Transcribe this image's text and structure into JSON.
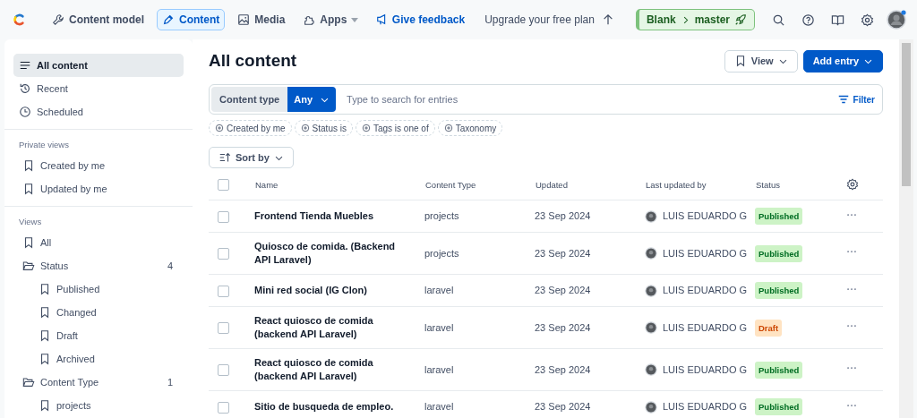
{
  "topbar": {
    "nav": [
      {
        "label": "Content model",
        "selected": false,
        "dropdown": false
      },
      {
        "label": "Content",
        "selected": true,
        "dropdown": false
      },
      {
        "label": "Media",
        "selected": false,
        "dropdown": false
      },
      {
        "label": "Apps",
        "selected": false,
        "dropdown": true
      }
    ],
    "feedback": "Give feedback",
    "upgrade": "Upgrade your free plan",
    "env_space": "Blank",
    "env_name": "master",
    "env_master": true
  },
  "sidebar": {
    "top": [
      {
        "label": "All content",
        "selected": true
      },
      {
        "label": "Recent",
        "selected": false
      },
      {
        "label": "Scheduled",
        "selected": false
      }
    ],
    "sections": [
      {
        "title": "Private views",
        "items": [
          {
            "label": "Created by me",
            "kind": "view",
            "selected": false
          },
          {
            "label": "Updated by me",
            "kind": "view",
            "selected": false
          }
        ]
      },
      {
        "title": "Views",
        "items": [
          {
            "label": "All",
            "kind": "view",
            "selected": false
          },
          {
            "label": "Status",
            "kind": "folder",
            "count": "4",
            "expanded": true,
            "children": [
              {
                "label": "Published",
                "kind": "view",
                "selected": false
              },
              {
                "label": "Changed",
                "kind": "view",
                "selected": false
              },
              {
                "label": "Draft",
                "kind": "view",
                "selected": false
              },
              {
                "label": "Archived",
                "kind": "view",
                "selected": false
              }
            ]
          },
          {
            "label": "Content Type",
            "kind": "folder",
            "count": "1",
            "expanded": true,
            "children": [
              {
                "label": "projects",
                "kind": "view",
                "selected": false
              }
            ]
          }
        ]
      }
    ]
  },
  "main": {
    "title": "All content",
    "view_button": "View",
    "add_button": "Add entry",
    "search": {
      "type_label": "Content type",
      "type_value": "Any",
      "placeholder": "Type to search for entries",
      "filter": "Filter"
    },
    "chips": [
      "Created by me",
      "Status is",
      "Tags is one of",
      "Taxonomy"
    ],
    "sort": "Sort by",
    "table": {
      "select_all_checked": false,
      "columns": [
        "Name",
        "Content Type",
        "Updated",
        "Last updated by",
        "Status"
      ],
      "rows": [
        {
          "name": "Frontend Tienda Muebles",
          "type": "projects",
          "updated": "23 Sep 2024",
          "by": "LUIS EDUARDO G",
          "status": "Published",
          "kind": "published",
          "checked": false
        },
        {
          "name": "Quiosco de comida. (Backend API Laravel)",
          "type": "projects",
          "updated": "23 Sep 2024",
          "by": "LUIS EDUARDO G",
          "status": "Published",
          "kind": "published",
          "checked": false
        },
        {
          "name": "Mini red social (IG Clon)",
          "type": "laravel",
          "updated": "23 Sep 2024",
          "by": "LUIS EDUARDO G",
          "status": "Published",
          "kind": "published",
          "checked": false
        },
        {
          "name": "React quiosco de comida (backend API Laravel)",
          "type": "laravel",
          "updated": "23 Sep 2024",
          "by": "LUIS EDUARDO G",
          "status": "Draft",
          "kind": "draft",
          "checked": false
        },
        {
          "name": "React quiosco de comida (backend API Laravel)",
          "type": "laravel",
          "updated": "23 Sep 2024",
          "by": "LUIS EDUARDO G",
          "status": "Published",
          "kind": "published",
          "checked": false
        },
        {
          "name": "Sitio de busqueda de empleo.",
          "type": "laravel",
          "updated": "23 Sep 2024",
          "by": "LUIS EDUARDO G",
          "status": "Published",
          "kind": "published",
          "checked": false
        }
      ]
    }
  }
}
